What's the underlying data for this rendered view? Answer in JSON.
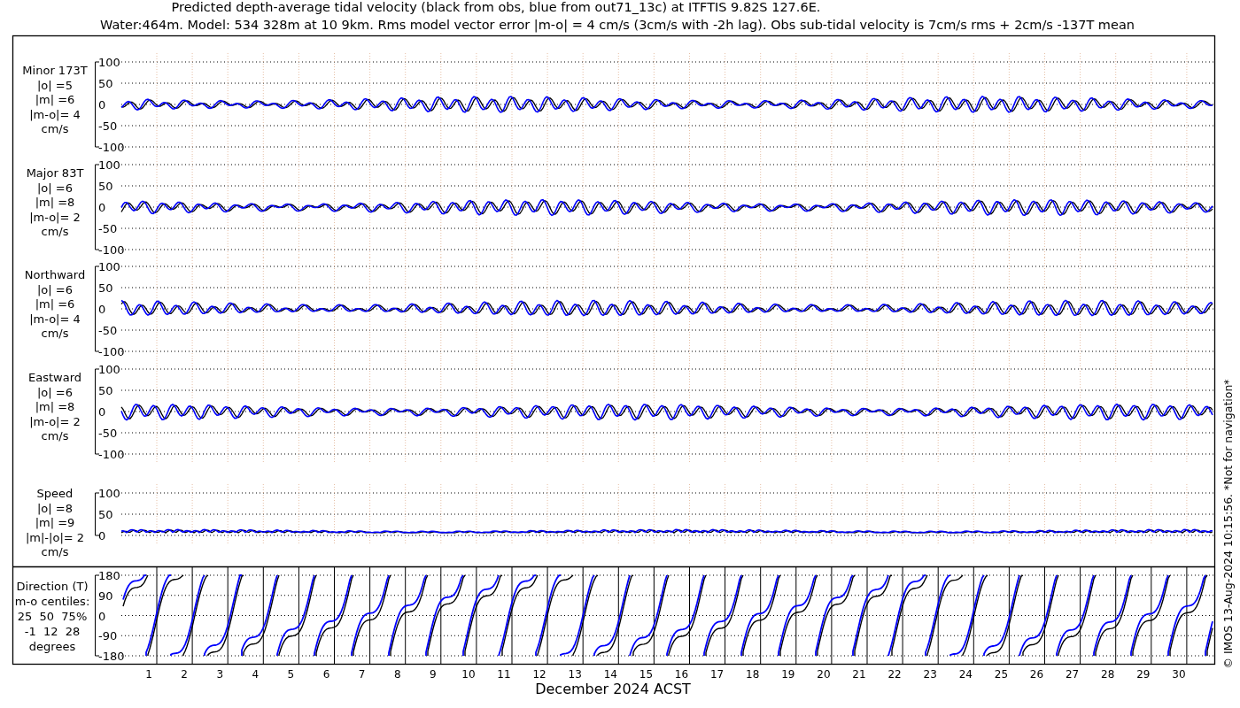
{
  "title_lines": [
    "Predicted depth-average tidal velocity (black from obs, blue from out71_13c) at ITFTIS 9.82S 127.6E.",
    "Water:464m. Model: 534 328m at 10 9km. Rms model vector error |m-o| = 4 cm/s (3cm/s with -2h lag). Obs sub-tidal velocity is 7cm/s rms + 2cm/s -137T mean"
  ],
  "panels": [
    {
      "kind": "signed",
      "label_lines": [
        "Minor 173T",
        "|o| =5",
        "|m| =6",
        "|m-o|= 4",
        "cm/s"
      ],
      "yticks": [
        "100",
        "50",
        "0",
        "-50",
        "-100"
      ]
    },
    {
      "kind": "signed",
      "label_lines": [
        "Major 83T",
        "|o| =6",
        "|m| =8",
        "|m-o|= 2",
        "cm/s"
      ],
      "yticks": [
        "100",
        "50",
        "0",
        "-50",
        "-100"
      ]
    },
    {
      "kind": "signed",
      "label_lines": [
        "Northward",
        "|o| =6",
        "|m| =6",
        "|m-o|= 4",
        "cm/s"
      ],
      "yticks": [
        "100",
        "50",
        "0",
        "-50",
        "-100"
      ]
    },
    {
      "kind": "signed",
      "label_lines": [
        "Eastward",
        "|o| =6",
        "|m| =8",
        "|m-o|= 2",
        "cm/s"
      ],
      "yticks": [
        "100",
        "50",
        "0",
        "-50",
        "-100"
      ]
    },
    {
      "kind": "magnitude",
      "label_lines": [
        "Speed",
        "|o| =8",
        "|m| =9",
        "|m|-|o|= 2",
        "cm/s"
      ],
      "yticks": [
        "100",
        "50",
        "0"
      ]
    }
  ],
  "direction_panel": {
    "label_lines": [
      "Direction (T)",
      "m-o centiles:",
      "25  50  75%",
      "-1  12  28",
      "degrees"
    ],
    "yticks": [
      "180",
      "90",
      "0",
      "-90",
      "-180"
    ]
  },
  "x_labels": [
    "1",
    "2",
    "3",
    "4",
    "5",
    "6",
    "7",
    "8",
    "9",
    "10",
    "11",
    "12",
    "13",
    "14",
    "15",
    "16",
    "17",
    "18",
    "19",
    "20",
    "21",
    "22",
    "23",
    "24",
    "25",
    "26",
    "27",
    "28",
    "29",
    "30"
  ],
  "xlabel": "December 2024 ACST",
  "credit": "© IMOS 13-Aug-2024 10:15:56. *Not for navigation*"
}
